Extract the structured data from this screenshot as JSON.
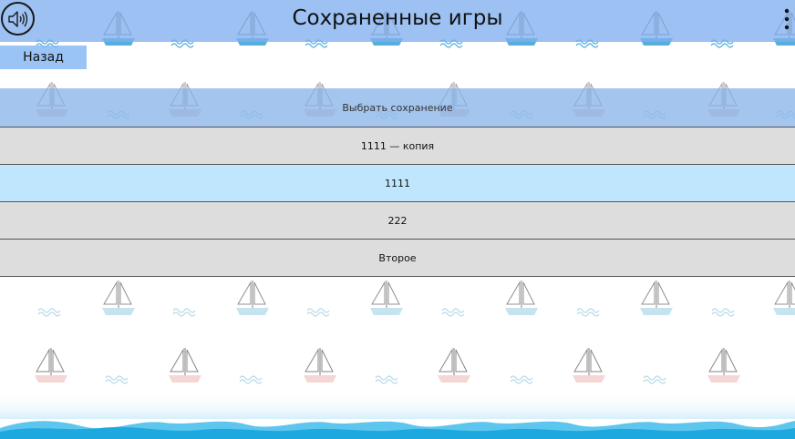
{
  "header": {
    "title": "Сохраненные игры",
    "sound_icon": "speaker-icon",
    "menu_icon": "more-vertical-icon"
  },
  "nav": {
    "back_label": "Назад"
  },
  "saves": {
    "header_label": "Выбрать сохранение",
    "items": [
      {
        "label": "1111 — копия",
        "selected": false
      },
      {
        "label": "1111",
        "selected": true
      },
      {
        "label": "222",
        "selected": false
      },
      {
        "label": "Второе",
        "selected": false
      }
    ]
  },
  "colors": {
    "header_bg": "#80b0ee",
    "row_bg": "#dddddd",
    "row_selected_bg": "#bfe6fd",
    "wave": "#1ea8e0"
  }
}
